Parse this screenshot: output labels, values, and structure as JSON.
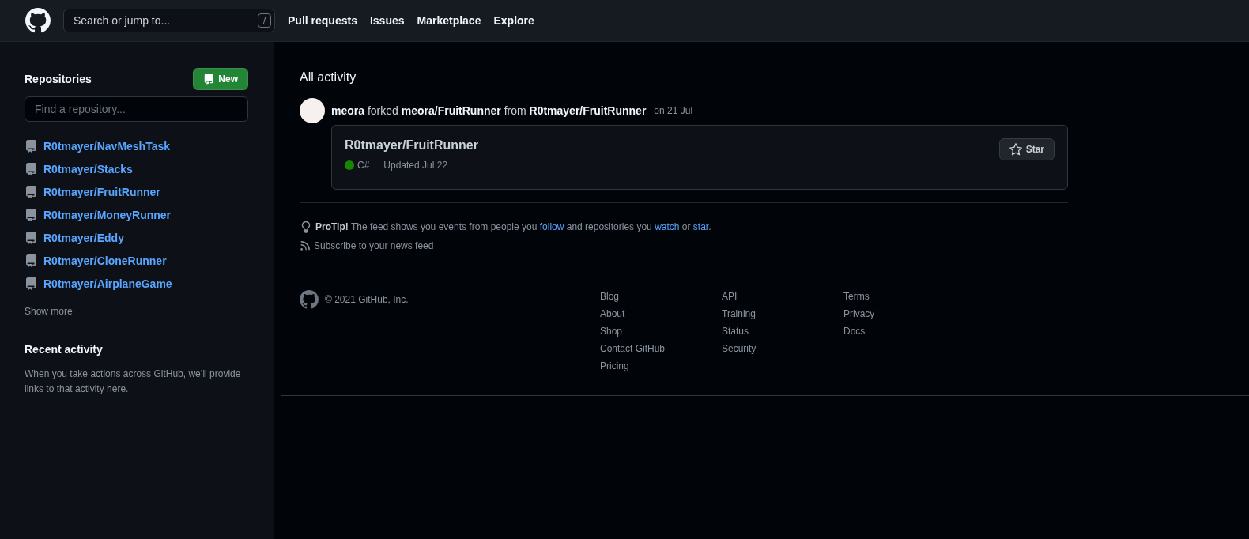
{
  "header": {
    "search": {
      "placeholder": "Search or jump to...",
      "shortcut": "/"
    },
    "nav": [
      "Pull requests",
      "Issues",
      "Marketplace",
      "Explore"
    ]
  },
  "sidebar": {
    "repositories_title": "Repositories",
    "new_button": "New",
    "filter": {
      "placeholder": "Find a repository..."
    },
    "repositories": [
      "R0tmayer/NavMeshTask",
      "R0tmayer/Stacks",
      "R0tmayer/FruitRunner",
      "R0tmayer/MoneyRunner",
      "R0tmayer/Eddy",
      "R0tmayer/CloneRunner",
      "R0tmayer/AirplaneGame"
    ],
    "show_more": "Show more",
    "recent_title": "Recent activity",
    "recent_text": "When you take actions across GitHub, we’ll provide links to that activity here."
  },
  "feed": {
    "title": "All activity",
    "event": {
      "parts": [
        {
          "kind": "link",
          "text": "meora"
        },
        {
          "kind": "text",
          "text": " forked "
        },
        {
          "kind": "link",
          "text": "meora/FruitRunner"
        },
        {
          "kind": "text",
          "text": " from "
        },
        {
          "kind": "link",
          "text": "R0tmayer/FruitRunner"
        }
      ],
      "time": "on 21 Jul"
    },
    "card": {
      "repo": "R0tmayer/FruitRunner",
      "language": {
        "name": "C#",
        "color": "#178600"
      },
      "updated": "Updated Jul 22",
      "star_button": "Star"
    },
    "protip": {
      "label": "ProTip!",
      "parts": [
        {
          "kind": "text",
          "text": " The feed shows you events from people you "
        },
        {
          "kind": "link",
          "text": "follow"
        },
        {
          "kind": "text",
          "text": " and repositories you "
        },
        {
          "kind": "link",
          "text": "watch"
        },
        {
          "kind": "text",
          "text": " or "
        },
        {
          "kind": "link",
          "text": "star"
        },
        {
          "kind": "text",
          "text": "."
        }
      ]
    },
    "subscribe": "Subscribe to your news feed"
  },
  "footer": {
    "copyright": "© 2021 GitHub, Inc.",
    "columns": [
      [
        "Blog",
        "About",
        "Shop",
        "Contact GitHub",
        "Pricing"
      ],
      [
        "API",
        "Training",
        "Status",
        "Security"
      ],
      [
        "Terms",
        "Privacy",
        "Docs"
      ]
    ]
  }
}
